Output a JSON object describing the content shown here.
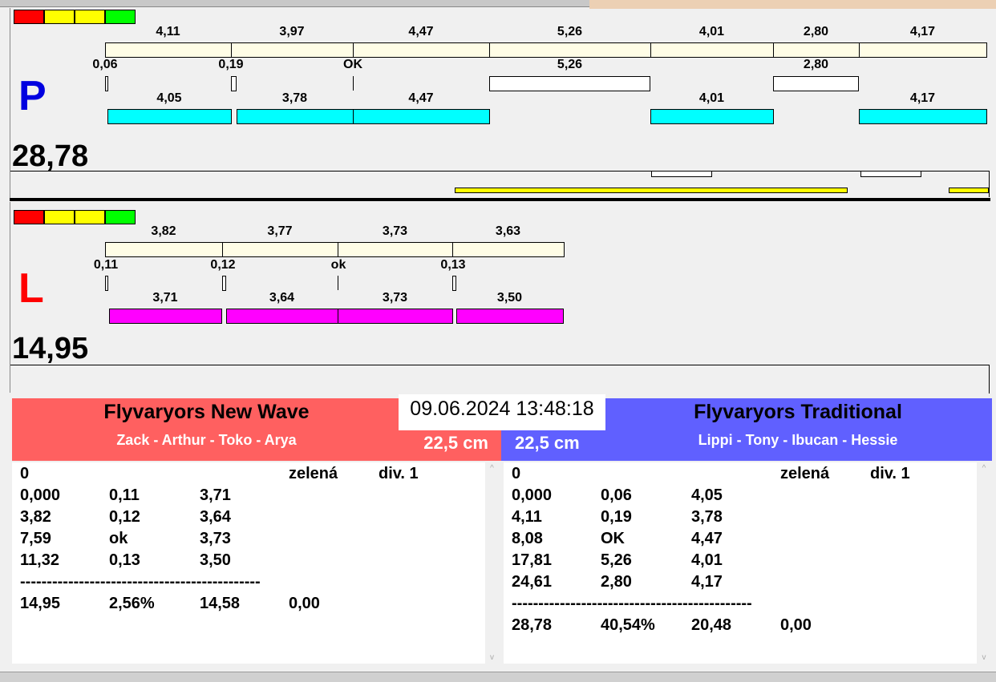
{
  "colors": {
    "red": "#ff0000",
    "yellow": "#ffff00",
    "green": "#00ff00",
    "cream": "#fffde6",
    "cyan": "#00ffff",
    "magenta": "#ff00ff",
    "team_left": "#ff6060",
    "team_right": "#6060ff"
  },
  "track_p": {
    "letter": "P",
    "total": "28,78",
    "top_labels": [
      "4,11",
      "3,97",
      "4,47",
      "5,26",
      "4,01",
      "2,80",
      "4,17"
    ],
    "mid_labels": [
      "0,06",
      "0,19",
      "OK",
      "5,26",
      "2,80"
    ],
    "bottom_labels": [
      "4,05",
      "3,78",
      "4,47",
      "4,01",
      "4,17"
    ]
  },
  "track_l": {
    "letter": "L",
    "total": "14,95",
    "top_labels": [
      "3,82",
      "3,77",
      "3,73",
      "3,63"
    ],
    "mid_labels": [
      "0,11",
      "0,12",
      "ok",
      "0,13"
    ],
    "bottom_labels": [
      "3,71",
      "3,64",
      "3,73",
      "3,50"
    ]
  },
  "datetime": "09.06.2024 13:48:18",
  "left_team": {
    "name": "Flyvaryors New Wave",
    "members": "Zack - Arthur - Toko - Arya",
    "distance": "22,5 cm",
    "rows": [
      [
        "0",
        "",
        "",
        "zelená",
        "div. 1"
      ],
      [
        "0,000",
        "0,11",
        "3,71"
      ],
      [
        "3,82",
        "0,12",
        "3,64"
      ],
      [
        "7,59",
        "ok",
        "3,73"
      ],
      [
        "11,32",
        "0,13",
        "3,50"
      ],
      [
        "---------------------------------------------"
      ],
      [
        "14,95",
        "2,56%",
        "14,58",
        "0,00"
      ]
    ]
  },
  "right_team": {
    "name": "Flyvaryors Traditional",
    "members": "Lippi - Tony - Ibucan - Hessie",
    "distance": "22,5 cm",
    "rows": [
      [
        "0",
        "",
        "",
        "zelená",
        "div. 1"
      ],
      [
        "0,000",
        "0,06",
        "4,05"
      ],
      [
        "4,11",
        "0,19",
        "3,78"
      ],
      [
        "8,08",
        "OK",
        "4,47"
      ],
      [
        "17,81",
        "5,26",
        "4,01"
      ],
      [
        "24,61",
        "2,80",
        "4,17"
      ],
      [
        "---------------------------------------------"
      ],
      [
        "28,78",
        "40,54%",
        "20,48",
        "0,00"
      ]
    ]
  }
}
